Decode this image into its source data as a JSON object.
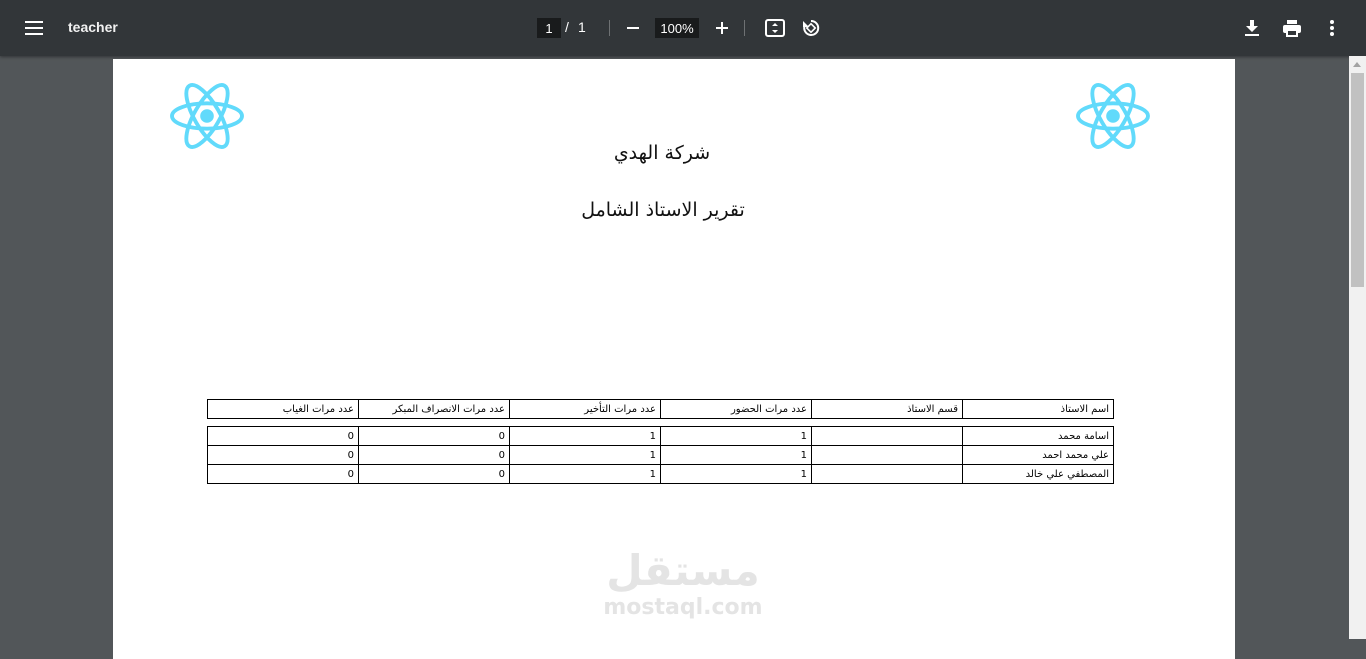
{
  "toolbar": {
    "title": "teacher",
    "page_current": "1",
    "page_separator": "/",
    "page_total": "1",
    "zoom": "100%",
    "icons": [
      "menu-icon",
      "zoom-out-icon",
      "zoom-in-icon",
      "fit-page-icon",
      "rotate-icon",
      "download-icon",
      "print-icon",
      "more-vert-icon"
    ]
  },
  "document": {
    "company": "شركة الهدي",
    "report_title": "تقرير الاستاذ الشامل",
    "table": {
      "headers": [
        "اسم الاستاذ",
        "قسم الاستاذ",
        "عدد مرات الحضور",
        "عدد مرات التأخير",
        "عدد مرات الانصراف المبكر",
        "عدد مرات الغياب"
      ],
      "rows": [
        [
          "اسامة محمد",
          "",
          "1",
          "1",
          "0",
          "0"
        ],
        [
          "علي محمد احمد",
          "",
          "1",
          "1",
          "0",
          "0"
        ],
        [
          "المصطفي علي خالد",
          "",
          "1",
          "1",
          "0",
          "0"
        ]
      ]
    },
    "watermark": {
      "arabic": "مستقل",
      "latin": "mostaql.com"
    }
  },
  "colors": {
    "toolbar_bg": "#323639",
    "viewer_bg": "#525659",
    "react_logo": "#61dafb"
  }
}
